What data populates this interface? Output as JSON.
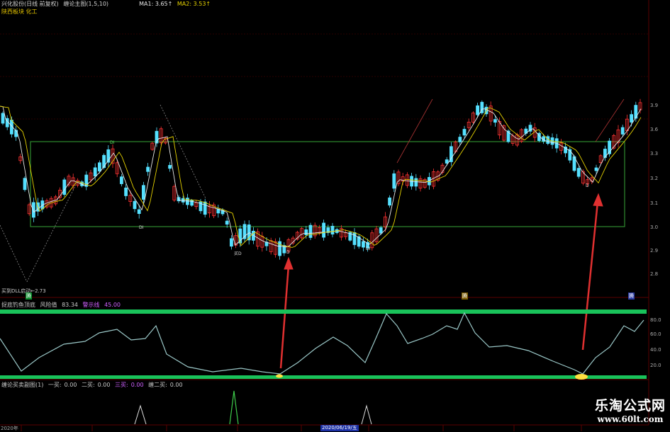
{
  "header": {
    "stock_title": "兴化股份(日线 前复权)",
    "indicator_name": "缠论主图(1,5,10)",
    "ma1_label": "MA1: 3.65↑",
    "ma2_label": "MA2: 3.53↑",
    "sector_label": "陕西板块 化工"
  },
  "main_chart": {
    "low_marker": "2.73",
    "low_marker_prefix": "买到DLL启动←",
    "right_axis": [
      "3.9",
      "3.6",
      "3.3",
      "3.2",
      "3.1",
      "3.0",
      "2.9",
      "2.8"
    ],
    "flags": [
      "腾",
      "腾",
      "腾"
    ],
    "labels": [
      "DI",
      "DI",
      "买D",
      "D",
      "DI",
      "D"
    ]
  },
  "oscillator": {
    "title": "捉底钓鱼顶底",
    "risk_label": "风险值",
    "risk_value": "83.34",
    "warn_label": "警示线",
    "warn_value": "45.00",
    "right_axis": [
      "80.0",
      "60.0",
      "40.0",
      "20.0"
    ]
  },
  "bottom_indicator": {
    "title": "缠论买卖副图(1)",
    "buy1_label": "一买:",
    "buy1_value": "0.00",
    "buy2_label": "二买:",
    "buy2_value": "0.00",
    "buy3_label": "三买:",
    "buy3_value": "0.00",
    "buy23_label": "缠二买:",
    "buy23_value": "0.00"
  },
  "time_axis": {
    "start_label": "2020年",
    "selected_date": "2020/06/19/五"
  },
  "watermark": {
    "title": "乐淘公式网",
    "url": "www.60lt.com"
  },
  "colors": {
    "background": "#000000",
    "up": "#ff3333",
    "down": "#55e0ff",
    "box": "#2e8b2e",
    "green_band": "#19c25a",
    "arrow": "#e03030"
  }
}
